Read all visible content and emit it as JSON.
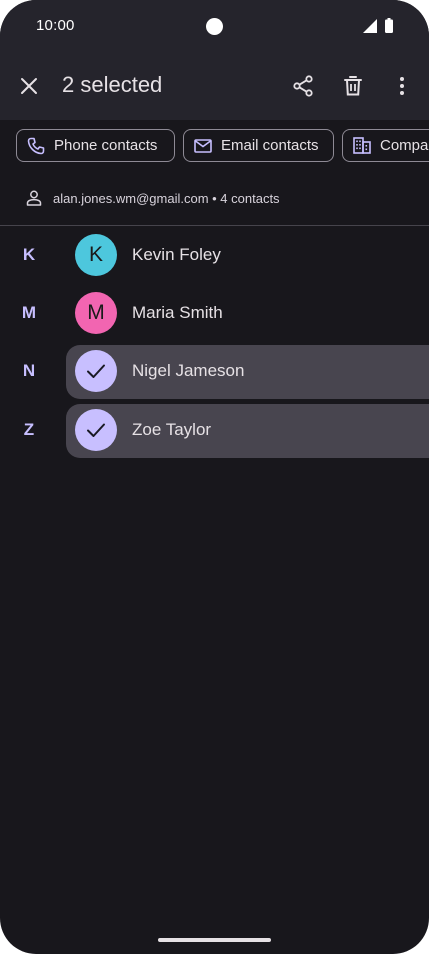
{
  "status": {
    "time": "10:00"
  },
  "appbar": {
    "title": "2 selected",
    "close_icon": "close-icon",
    "actions": [
      "share-icon",
      "delete-icon",
      "more-vert-icon"
    ]
  },
  "chips": [
    {
      "label": "Phone contacts",
      "icon": "phone-icon"
    },
    {
      "label": "Email contacts",
      "icon": "email-icon"
    },
    {
      "label": "Compar",
      "icon": "business-icon"
    }
  ],
  "account": {
    "text": "alan.jones.wm@gmail.com • 4 contacts"
  },
  "contacts": [
    {
      "letter": "K",
      "initial": "K",
      "name": "Kevin Foley",
      "selected": false,
      "color": "#4dc7dd"
    },
    {
      "letter": "M",
      "initial": "M",
      "name": "Maria Smith",
      "selected": false,
      "color": "#f265b1"
    },
    {
      "letter": "N",
      "initial": "",
      "name": "Nigel Jameson",
      "selected": true,
      "color": "#c8bfff"
    },
    {
      "letter": "Z",
      "initial": "",
      "name": "Zoe Taylor",
      "selected": true,
      "color": "#c8bfff"
    }
  ],
  "colors": {
    "background": "#18171c",
    "appbar": "#25242c",
    "accent_letter": "#c7bfff",
    "selected_row": "#48454f"
  }
}
